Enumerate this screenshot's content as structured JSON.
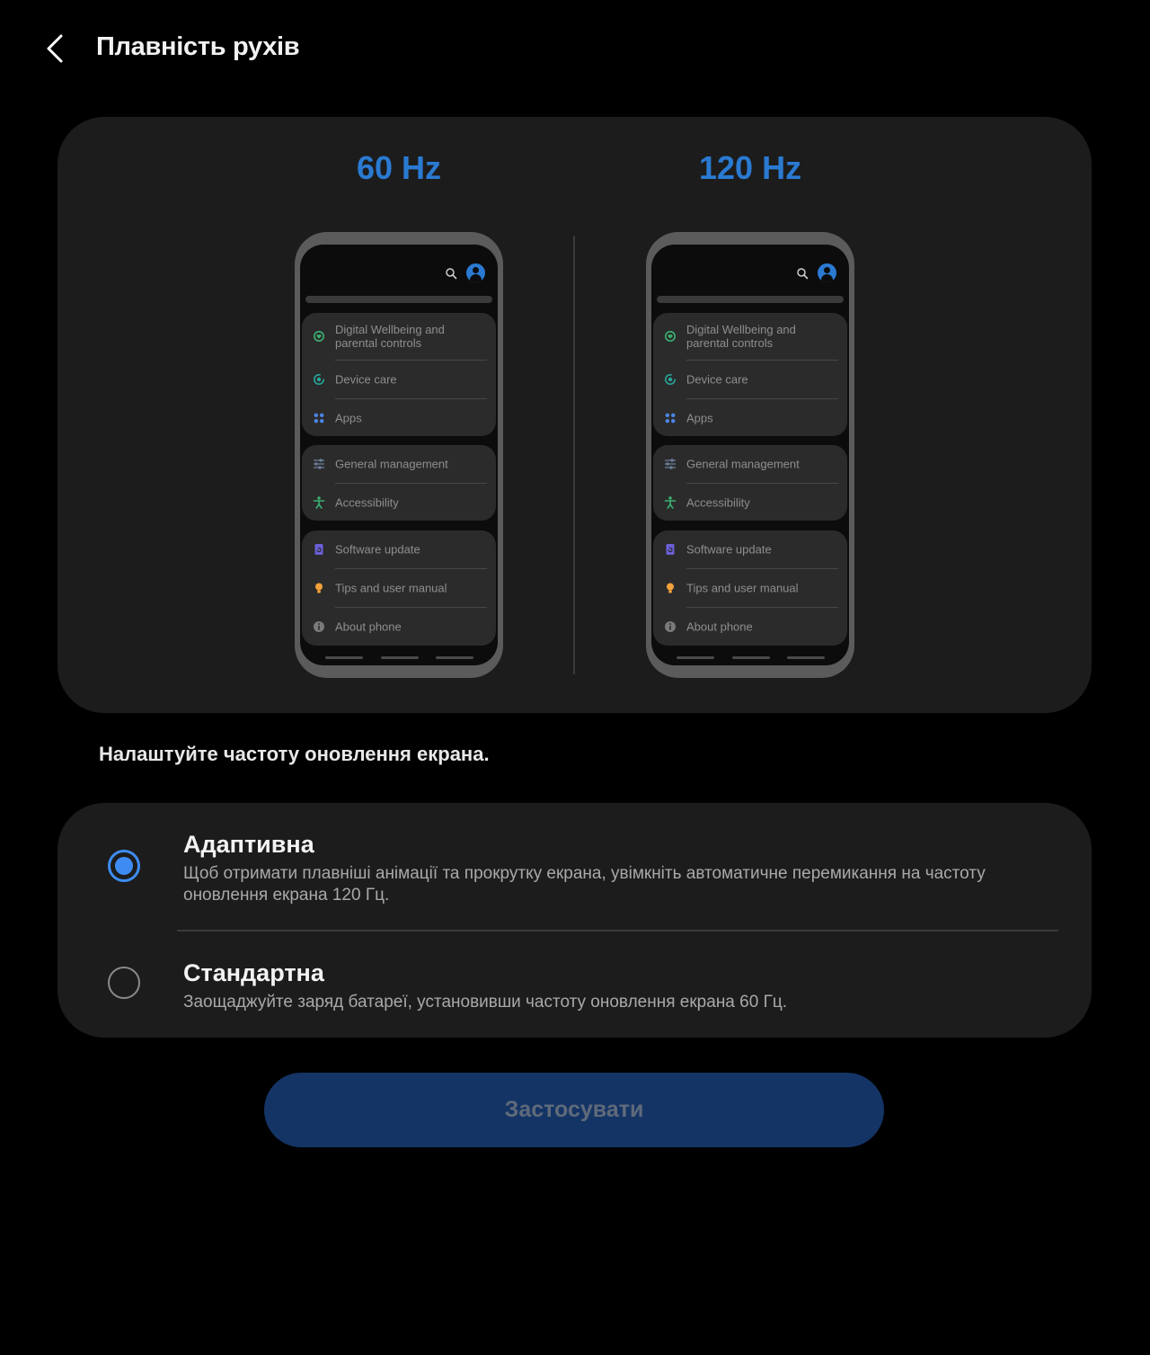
{
  "header": {
    "title": "Плавність рухів",
    "back_icon": "chevron-left-icon"
  },
  "preview": {
    "left_label": "60 Hz",
    "right_label": "120 Hz",
    "accent_color": "#2a7ad2",
    "phone_items": [
      {
        "label": "Digital Wellbeing and parental controls",
        "icon": "wellbeing-icon",
        "color": "#3bb273"
      },
      {
        "label": "Device care",
        "icon": "device-care-icon",
        "color": "#26a69a"
      },
      {
        "label": "Apps",
        "icon": "apps-icon",
        "color": "#4a86e8"
      },
      {
        "label": "General management",
        "icon": "sliders-icon",
        "color": "#6b7d99"
      },
      {
        "label": "Accessibility",
        "icon": "accessibility-icon",
        "color": "#3bb273"
      },
      {
        "label": "Software update",
        "icon": "software-update-icon",
        "color": "#6a5fd6"
      },
      {
        "label": "Tips and user manual",
        "icon": "lightbulb-icon",
        "color": "#f2a13a"
      },
      {
        "label": "About phone",
        "icon": "info-icon",
        "color": "#7a7a7a"
      }
    ]
  },
  "caption": "Налаштуйте частоту оновлення екрана.",
  "options": [
    {
      "title": "Адаптивна",
      "description": "Щоб отримати плавніші анімації та прокрутку екрана, увімкніть автоматичне перемикання на частоту оновлення екрана 120 Гц.",
      "selected": true
    },
    {
      "title": "Стандартна",
      "description": "Заощаджуйте заряд батареї, установивши частоту оновлення екрана 60 Гц.",
      "selected": false
    }
  ],
  "apply_button": {
    "label": "Застосувати",
    "background": "#143465",
    "text_color": "#5f6a7a"
  },
  "radio_color": "#3e8cf3"
}
